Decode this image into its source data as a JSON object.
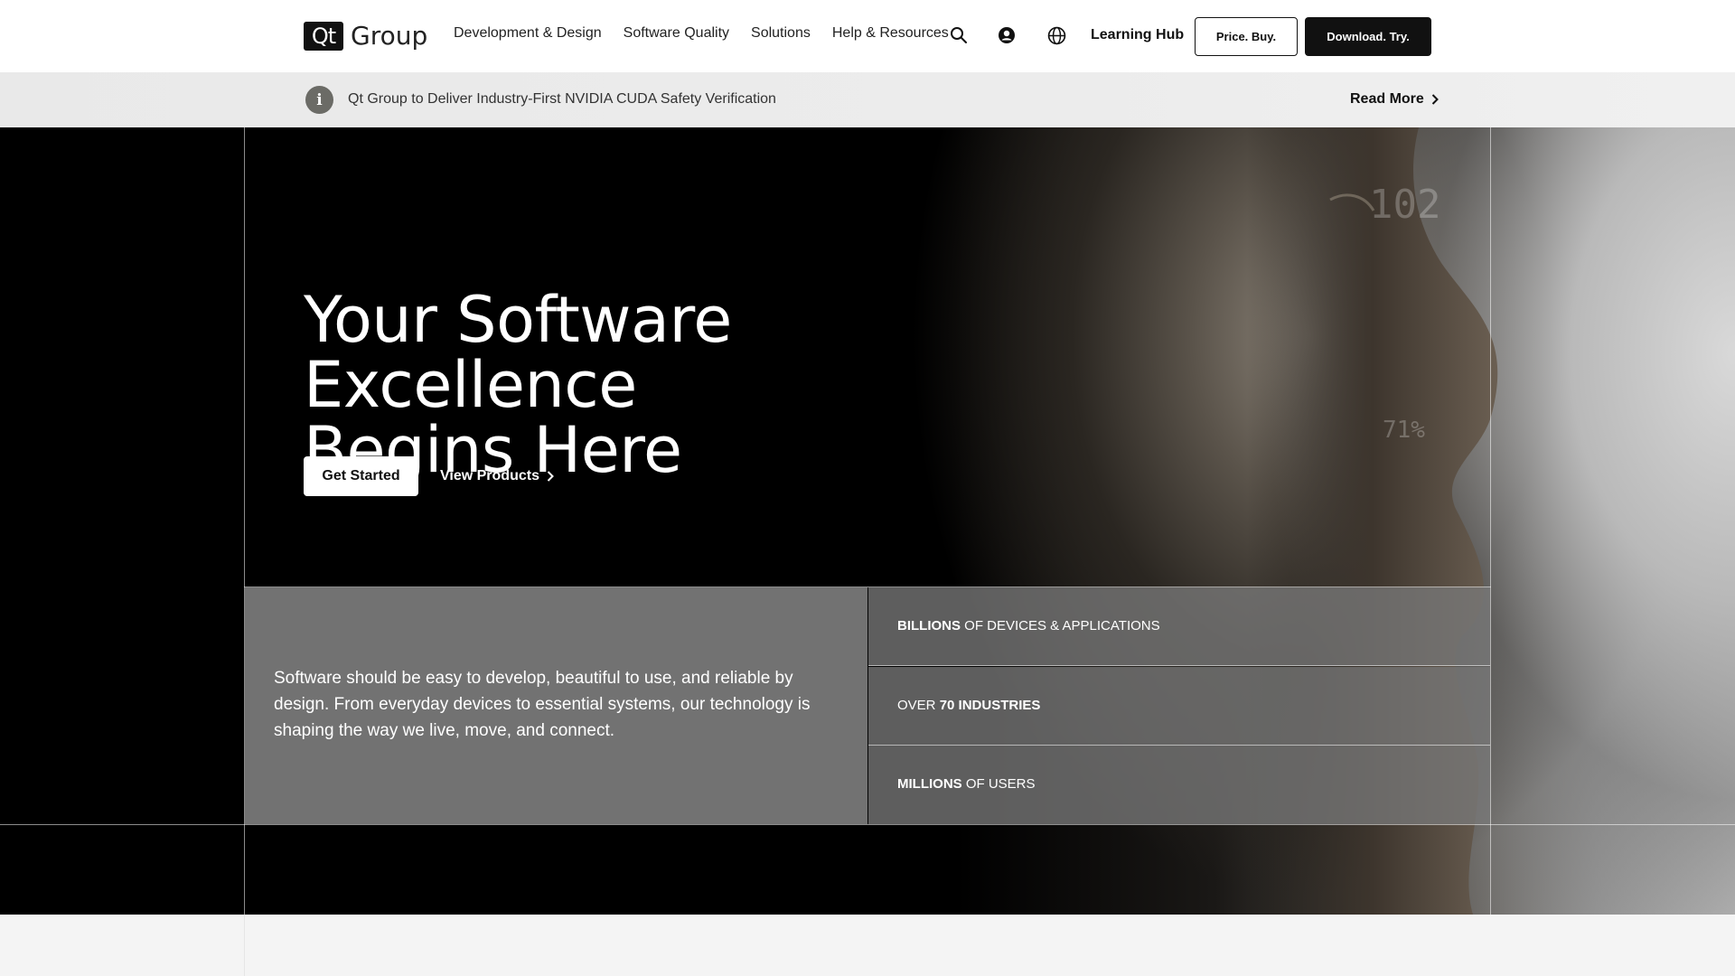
{
  "header": {
    "logo_badge": "Qt",
    "logo_text": "Group",
    "nav": [
      "Development & Design",
      "Software Quality",
      "Solutions",
      "Help & Resources"
    ],
    "icons": [
      "search-icon",
      "user-icon",
      "globe-icon"
    ],
    "learning_hub": "Learning Hub",
    "price_buy": "Price. Buy.",
    "download_try": "Download. Try."
  },
  "announcement": {
    "icon": "info-icon",
    "icon_glyph": "i",
    "text": "Qt Group to Deliver Industry-First NVIDIA CUDA Safety Verification",
    "read_more": "Read More"
  },
  "hero": {
    "title_line1": "Your Software Excellence",
    "title_line2": "Begins Here",
    "get_started": "Get Started",
    "view_products": "View Products",
    "hud": {
      "big_number": "102",
      "percent": "71%"
    }
  },
  "panel": {
    "description": "Software should be easy to develop, beautiful to use, and reliable by design. From everyday devices to essential systems, our technology is shaping the way we live, move, and connect.",
    "stats": [
      {
        "bold": "BILLIONS",
        "rest": " OF DEVICES & APPLICATIONS",
        "bold_first": true
      },
      {
        "lead": "OVER ",
        "bold": "70 INDUSTRIES",
        "bold_first": false
      },
      {
        "bold": "MILLIONS",
        "rest": " OF USERS",
        "bold_first": true
      }
    ]
  },
  "colors": {
    "header_bg": "#ffffff",
    "announce_bg": "#ececec",
    "hero_bg": "#000000",
    "panel_bg": "#828282",
    "accent": "#111111"
  }
}
